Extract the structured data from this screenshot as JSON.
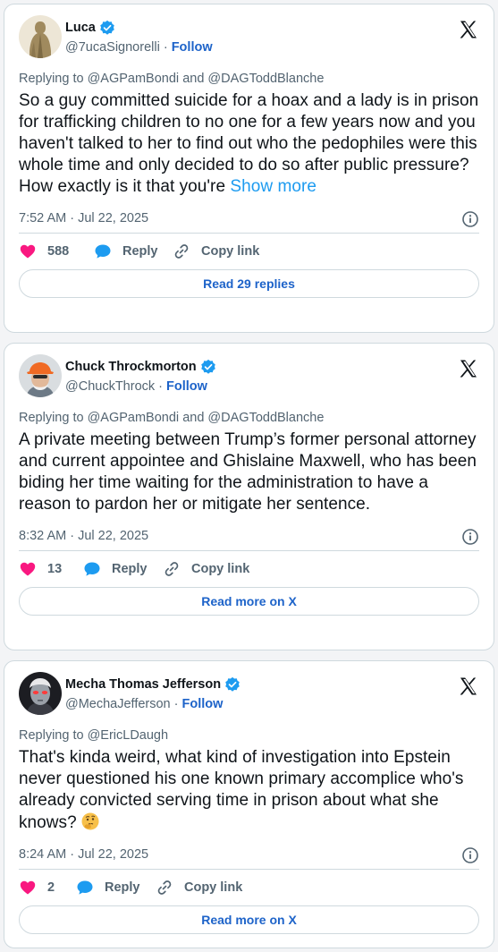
{
  "tweets": [
    {
      "name": "Luca",
      "handle": "@7ucaSignorelli",
      "follow_label": "Follow",
      "reply_prefix": "Replying to",
      "reply_users": [
        "@AGPamBondi",
        "@DAGToddBlanche"
      ],
      "reply_conj": "and",
      "text": "So a guy committed suicide for a hoax and a lady is in prison for trafficking children to no one for a few years now and you haven't talked to her to find out who the pedophiles were this whole time and only decided to do so after public pressure? How exactly is it that you're",
      "show_more": "Show more",
      "timestamp": "7:52 AM · Jul 22, 2025",
      "likes": "588",
      "reply_label": "Reply",
      "copy_label": "Copy link",
      "button_label": "Read 29 replies"
    },
    {
      "name": "Chuck Throckmorton",
      "handle": "@ChuckThrock",
      "follow_label": "Follow",
      "reply_prefix": "Replying to",
      "reply_users": [
        "@AGPamBondi",
        "@DAGToddBlanche"
      ],
      "reply_conj": "and",
      "text": "A private meeting between Trump’s former personal attorney and current appointee and Ghislaine Maxwell, who has been biding her time waiting for the administration to have a reason to pardon her or mitigate her sentence.",
      "timestamp": "8:32 AM · Jul 22, 2025",
      "likes": "13",
      "reply_label": "Reply",
      "copy_label": "Copy link",
      "button_label": "Read more on X"
    },
    {
      "name": "Mecha Thomas Jefferson",
      "handle": "@MechaJefferson",
      "follow_label": "Follow",
      "reply_prefix": "Replying to",
      "reply_users": [
        "@EricLDaugh"
      ],
      "text": "That's kinda weird, what kind of investigation into Epstein never questioned his one known primary accomplice who's already convicted serving time in prison about what she knows?",
      "emoji": "thinking-face",
      "timestamp": "8:24 AM · Jul 22, 2025",
      "likes": "2",
      "reply_label": "Reply",
      "copy_label": "Copy link",
      "button_label": "Read more on X"
    }
  ],
  "icons": {
    "verified": "verified-badge-icon",
    "brand": "x-logo-icon",
    "info": "info-icon",
    "like": "heart-icon",
    "reply": "reply-bubble-icon",
    "copy": "link-icon"
  },
  "colors": {
    "accent": "#1d9bf0",
    "link": "#1d63c9",
    "like": "#f91880",
    "muted": "#536471",
    "border": "#cfd9de"
  }
}
